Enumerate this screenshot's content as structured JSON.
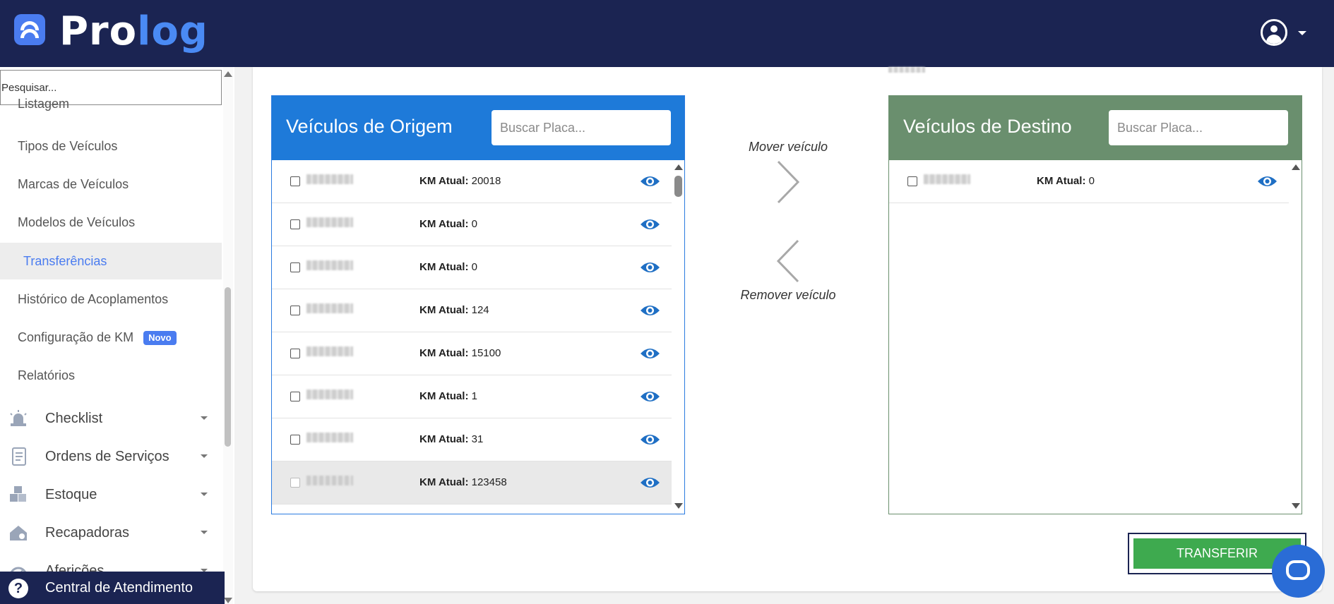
{
  "header": {
    "logo_pro": "Pro",
    "logo_log": "log"
  },
  "sidebar": {
    "search_placeholder": "Pesquisar...",
    "sub_items": [
      {
        "label": "Listagem"
      },
      {
        "label": "Tipos de Veículos"
      },
      {
        "label": "Marcas de Veículos"
      },
      {
        "label": "Modelos de Veículos"
      },
      {
        "label": "Transferências",
        "active": true
      },
      {
        "label": "Histórico de Acoplamentos"
      },
      {
        "label": "Configuração de KM",
        "badge": "Novo"
      },
      {
        "label": "Relatórios"
      }
    ],
    "main_items": [
      {
        "label": "Checklist",
        "icon": "alarm-siren-icon"
      },
      {
        "label": "Ordens de Serviços",
        "icon": "document-list-icon"
      },
      {
        "label": "Estoque",
        "icon": "boxes-icon"
      },
      {
        "label": "Recapadoras",
        "icon": "house-gear-icon"
      },
      {
        "label": "Aferições",
        "icon": "gauge-icon"
      }
    ],
    "central_label": "Central de Atendimento",
    "colors": {
      "accent": "#4a7cf0",
      "navy": "#1b2452"
    }
  },
  "origin_panel": {
    "title": "Veículos de Origem",
    "search_placeholder": "Buscar Placa...",
    "km_label": "KM Atual:",
    "rows": [
      {
        "km": "20018"
      },
      {
        "km": "0"
      },
      {
        "km": "0"
      },
      {
        "km": "124"
      },
      {
        "km": "15100"
      },
      {
        "km": "1"
      },
      {
        "km": "31"
      },
      {
        "km": "123458"
      }
    ]
  },
  "dest_panel": {
    "title": "Veículos de Destino",
    "search_placeholder": "Buscar Placa...",
    "km_label": "KM Atual:",
    "rows": [
      {
        "km": "0"
      }
    ]
  },
  "actions": {
    "move_label": "Mover veículo",
    "remove_label": "Remover veículo",
    "transfer_label": "TRANSFERIR"
  }
}
